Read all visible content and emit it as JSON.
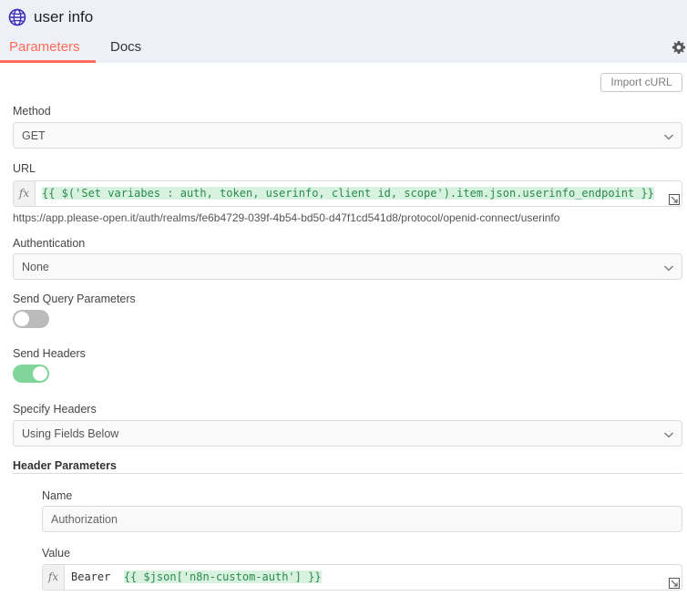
{
  "node": {
    "title": "user info",
    "icon": "globe-icon"
  },
  "tabs": [
    {
      "label": "Parameters",
      "active": true
    },
    {
      "label": "Docs",
      "active": false
    }
  ],
  "toolbar": {
    "settings_icon": "gear-icon",
    "import_label": "Import cURL"
  },
  "method": {
    "label": "Method",
    "value": "GET"
  },
  "url": {
    "label": "URL",
    "expression": "{{ $('Set variabes : auth, token, userinfo, client id, scope').item.json.userinfo_endpoint }}",
    "resolved": "https://app.please-open.it/auth/realms/fe6b4729-039f-4b54-bd50-d47f1cd541d8/protocol/openid-connect/userinfo"
  },
  "authentication": {
    "label": "Authentication",
    "value": "None"
  },
  "send_query": {
    "label": "Send Query Parameters",
    "enabled": false
  },
  "send_headers": {
    "label": "Send Headers",
    "enabled": true
  },
  "specify_headers": {
    "label": "Specify Headers",
    "value": "Using Fields Below"
  },
  "header_params": {
    "label": "Header Parameters",
    "name_label": "Name",
    "name_value": "Authorization",
    "value_label": "Value",
    "value_prefix": "Bearer",
    "value_expression": "{{ $json['n8n-custom-auth'] }}"
  },
  "fx_label": "fx",
  "colors": {
    "accent": "#ff6d5a",
    "toggle_on": "#7fd59a",
    "toggle_off": "#bbbbbb",
    "expression_bg": "#d9f2e0",
    "expression_text": "#2a8a4d"
  }
}
